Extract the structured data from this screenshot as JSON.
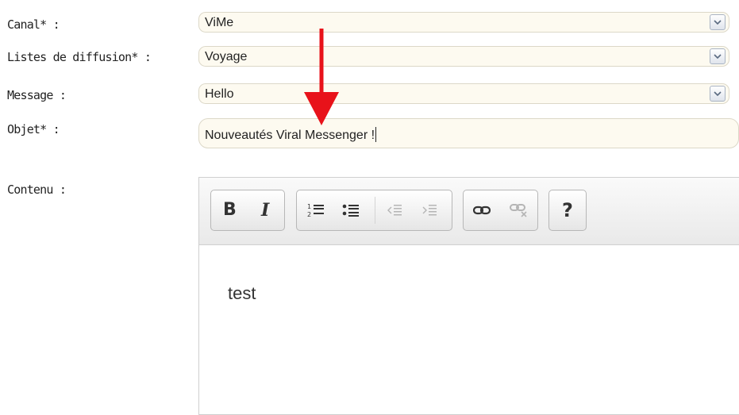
{
  "form": {
    "canal": {
      "label": "Canal* :",
      "value": "ViMe"
    },
    "listes": {
      "label": "Listes de diffusion* :",
      "value": "Voyage"
    },
    "message": {
      "label": "Message :",
      "value": "Hello"
    },
    "objet": {
      "label": "Objet* :",
      "value": "Nouveautés Viral Messenger !"
    },
    "contenu": {
      "label": "Contenu :"
    }
  },
  "editor": {
    "toolbar": {
      "bold": "B",
      "italic": "I",
      "help": "?"
    },
    "content": "test"
  },
  "annotation": {
    "arrow_color": "#e8121a"
  },
  "colors": {
    "field_bg": "#fdfaf0",
    "field_border": "#dcd8c8"
  }
}
